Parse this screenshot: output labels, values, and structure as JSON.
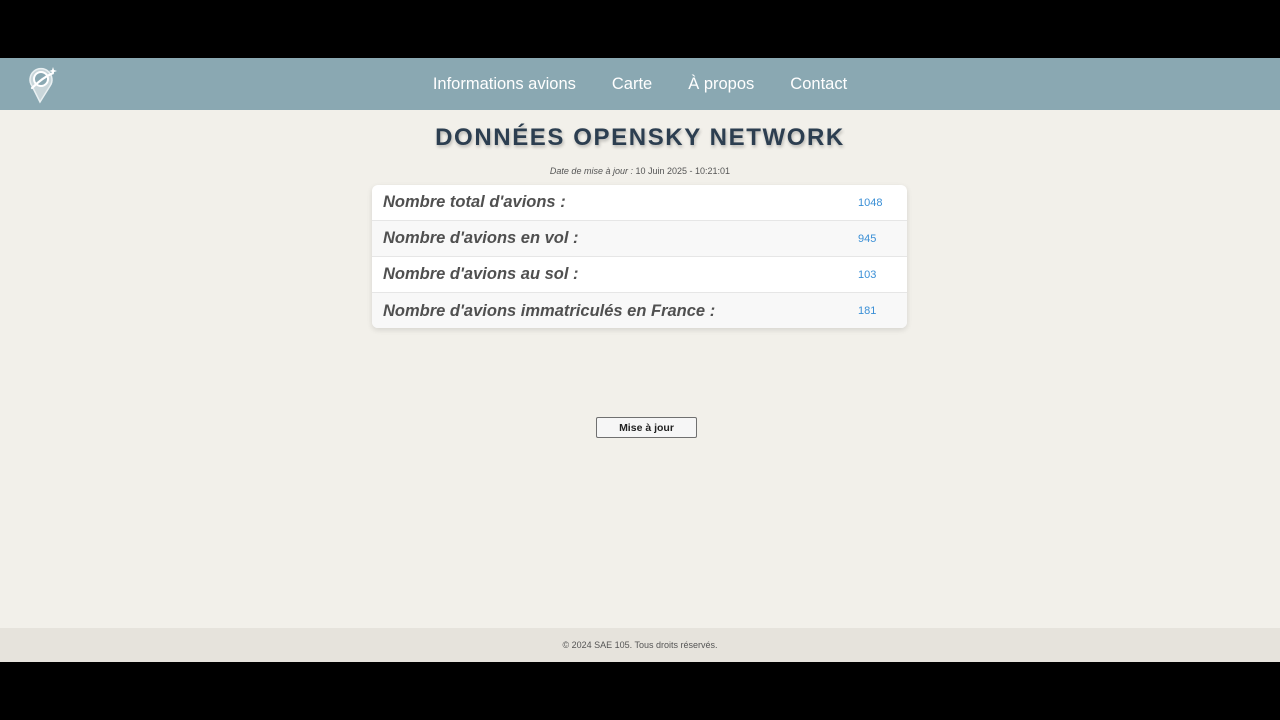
{
  "nav": {
    "links": [
      "Informations avions",
      "Carte",
      "À propos",
      "Contact"
    ]
  },
  "logo": {
    "icon": "compass-pin-logo"
  },
  "page": {
    "title": "DONNÉES OPENSKY NETWORK",
    "update_label": "Date de mise à jour :",
    "update_value": "10 Juin 2025 - 10:21:01"
  },
  "stats": [
    {
      "label": "Nombre total d'avions :",
      "value": "1048"
    },
    {
      "label": "Nombre d'avions en vol :",
      "value": "945"
    },
    {
      "label": "Nombre d'avions au sol :",
      "value": "103"
    },
    {
      "label": "Nombre d'avions immatriculés en France :",
      "value": "181"
    }
  ],
  "actions": {
    "update_button": "Mise à jour"
  },
  "footer": {
    "text": "© 2024 SAE 105. Tous droits réservés."
  },
  "colors": {
    "navbar": "#8aa8b2",
    "background": "#f2f0ea",
    "title": "#2c3e50",
    "value": "#3a8fd6"
  }
}
